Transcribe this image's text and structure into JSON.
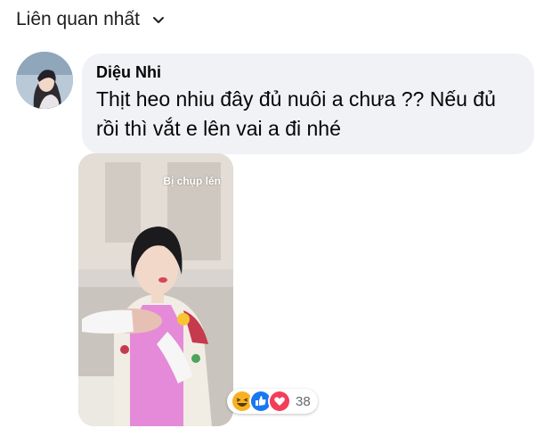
{
  "sort": {
    "label": "Liên quan nhất",
    "icon": "chevron-down-icon"
  },
  "comment": {
    "author": "Diệu Nhi",
    "text": "Thịt heo nhiu đây đủ nuôi a chưa ?? Nếu đủ rồi thì vắt e lên vai a đi nhé",
    "photo_caption": "Bị chụp lén",
    "reactions": {
      "icons": [
        "haha-icon",
        "like-icon",
        "love-icon"
      ],
      "count": "38"
    }
  },
  "colors": {
    "bubble_bg": "#f0f2f5",
    "like_blue": "#1877f2",
    "love_red": "#f33e58",
    "haha_yellow": "#f7b125",
    "apron_pink": "#e58ad8"
  }
}
